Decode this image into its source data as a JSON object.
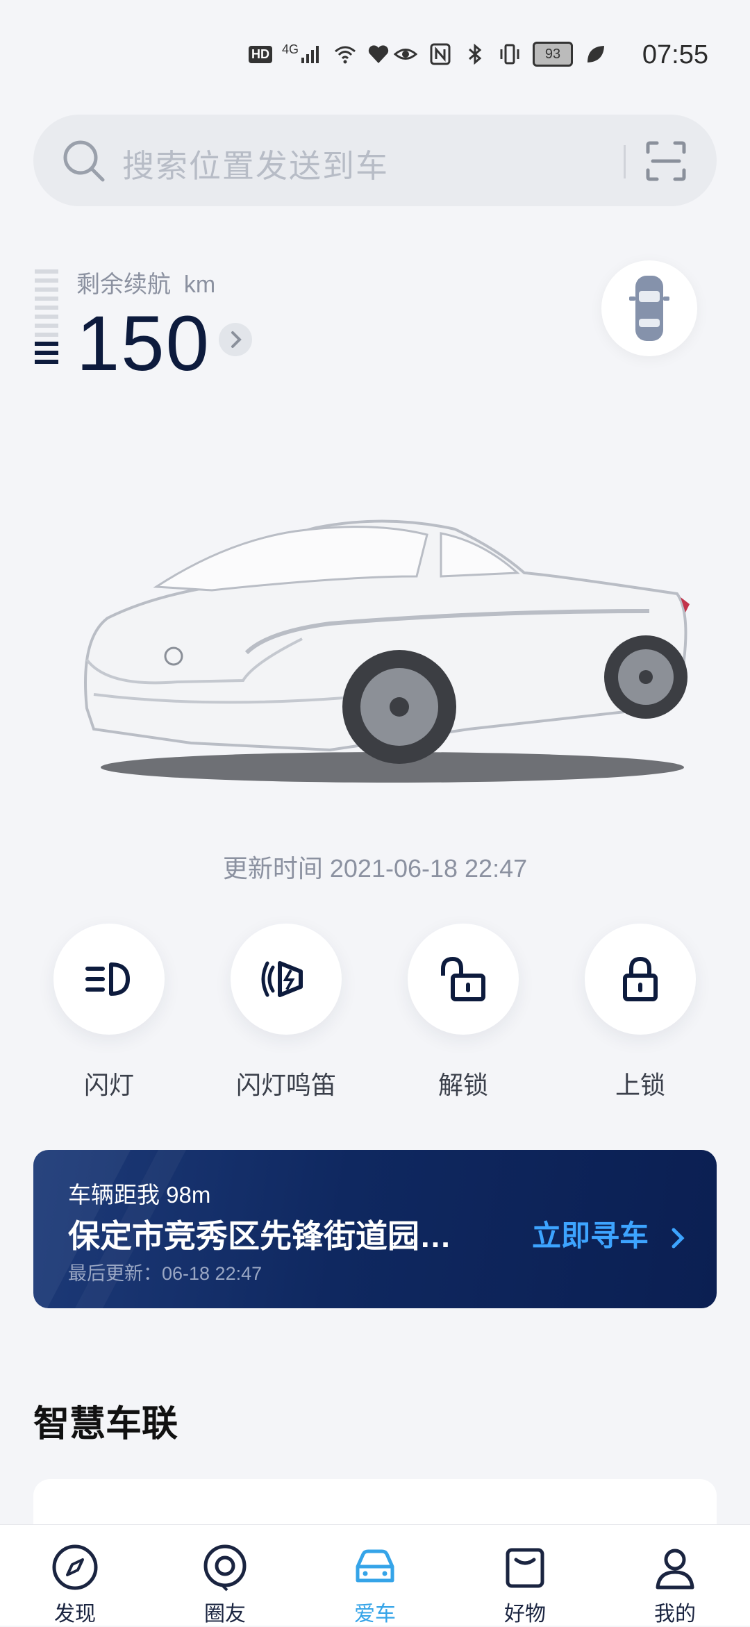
{
  "status_bar": {
    "time": "07:55",
    "battery": "93",
    "network": "4G",
    "hd": "HD"
  },
  "search": {
    "placeholder": "搜索位置发送到车"
  },
  "range": {
    "label": "剩余续航",
    "unit": "km",
    "value": "150"
  },
  "update_time": "更新时间 2021-06-18 22:47",
  "controls": [
    {
      "label": "闪灯",
      "icon": "headlight-icon"
    },
    {
      "label": "闪灯鸣笛",
      "icon": "horn-flash-icon"
    },
    {
      "label": "解锁",
      "icon": "unlock-icon"
    },
    {
      "label": "上锁",
      "icon": "lock-icon"
    }
  ],
  "find_car": {
    "distance": "车辆距我 98m",
    "address": "保定市竞秀区先锋街道园…",
    "last_update": "最后更新：06-18 22:47",
    "button": "立即寻车"
  },
  "section": {
    "title": "智慧车联"
  },
  "bottom_nav": [
    {
      "label": "发现",
      "icon": "compass-icon"
    },
    {
      "label": "圈友",
      "icon": "chat-icon"
    },
    {
      "label": "爱车",
      "icon": "car-icon",
      "active": true
    },
    {
      "label": "好物",
      "icon": "bag-icon"
    },
    {
      "label": "我的",
      "icon": "profile-icon"
    }
  ],
  "colors": {
    "accent": "#35a4e8",
    "navy": "#0d1b3d",
    "card_bg": "#0f2860"
  }
}
